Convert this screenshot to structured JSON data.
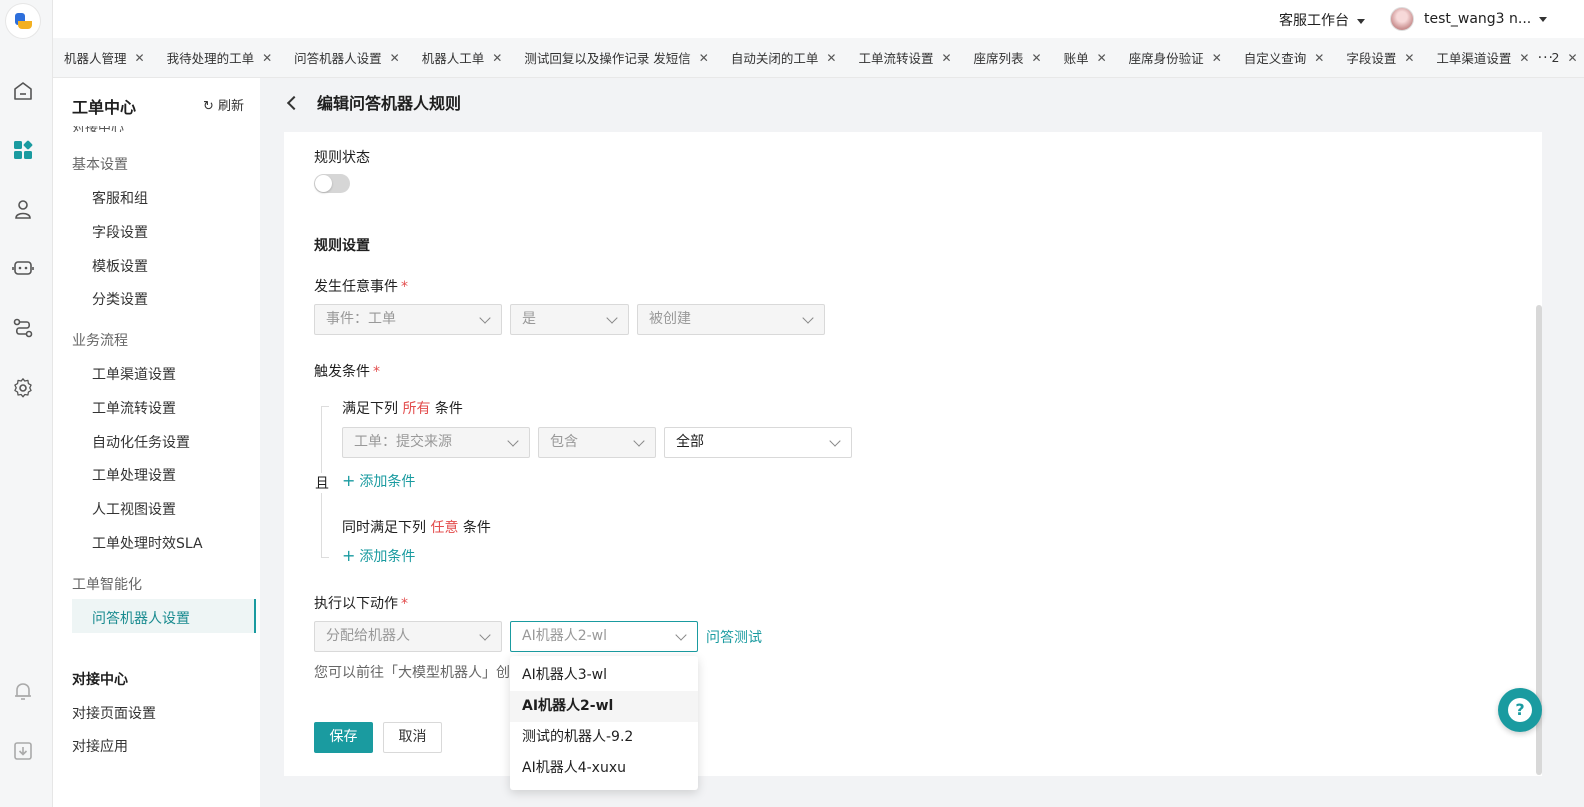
{
  "topbar": {
    "workspace": "客服工作台",
    "username": "test_wang3 n..."
  },
  "tabs": [
    {
      "label": "机器人管理"
    },
    {
      "label": "我待处理的工单"
    },
    {
      "label": "问答机器人设置"
    },
    {
      "label": "机器人工单"
    },
    {
      "label": "测试回复以及操作记录 发短信"
    },
    {
      "label": "自动关闭的工单"
    },
    {
      "label": "工单流转设置"
    },
    {
      "label": "座席列表"
    },
    {
      "label": "账单"
    },
    {
      "label": "座席身份验证"
    },
    {
      "label": "自定义查询"
    },
    {
      "label": "字段设置"
    },
    {
      "label": "工单渠道设置"
    },
    {
      "label": "2"
    }
  ],
  "tabs_more": "···",
  "sidebar": {
    "title": "工单中心",
    "refresh": "刷新",
    "groups": {
      "basic": "基本设置",
      "basic_items": [
        "客服和组",
        "字段设置",
        "模板设置",
        "分类设置"
      ],
      "flow": "业务流程",
      "flow_items": [
        "工单渠道设置",
        "工单流转设置",
        "自动化任务设置",
        "工单处理设置",
        "人工视图设置",
        "工单处理时效SLA"
      ],
      "smart": "工单智能化",
      "smart_items": [
        "问答机器人设置"
      ],
      "connect": "对接中心",
      "connect_items": [
        "对接页面设置",
        "对接应用"
      ]
    }
  },
  "main": {
    "title": "编辑问答机器人规则",
    "rule_status_label": "规则状态",
    "rule_settings_label": "规则设置",
    "event_label": "发生任意事件",
    "event_select1": "事件：工单",
    "event_select2": "是",
    "event_select3": "被创建",
    "trigger_label": "触发条件",
    "all_prefix": "满足下列",
    "all_word": "所有",
    "all_suffix": "条件",
    "cond_select1": "工单：提交来源",
    "cond_select2": "包含",
    "cond_select3": "全部",
    "and_label": "且",
    "add_condition": "添加条件",
    "any_prefix": "同时满足下列",
    "any_word": "任意",
    "any_suffix": "条件",
    "action_label": "执行以下动作",
    "action_select1": "分配给机器人",
    "action_select2": "AI机器人2-wl",
    "qa_test": "问答测试",
    "hint": "您可以前往「大模型机器人」创",
    "save": "保存",
    "cancel": "取消"
  },
  "dropdown": {
    "options": [
      "AI机器人3-wl",
      "AI机器人2-wl",
      "测试的机器人-9.2",
      "AI机器人4-xuxu"
    ],
    "selected": "AI机器人2-wl"
  },
  "colors": {
    "accent": "#1a9ba0",
    "required": "#e34d4d"
  }
}
